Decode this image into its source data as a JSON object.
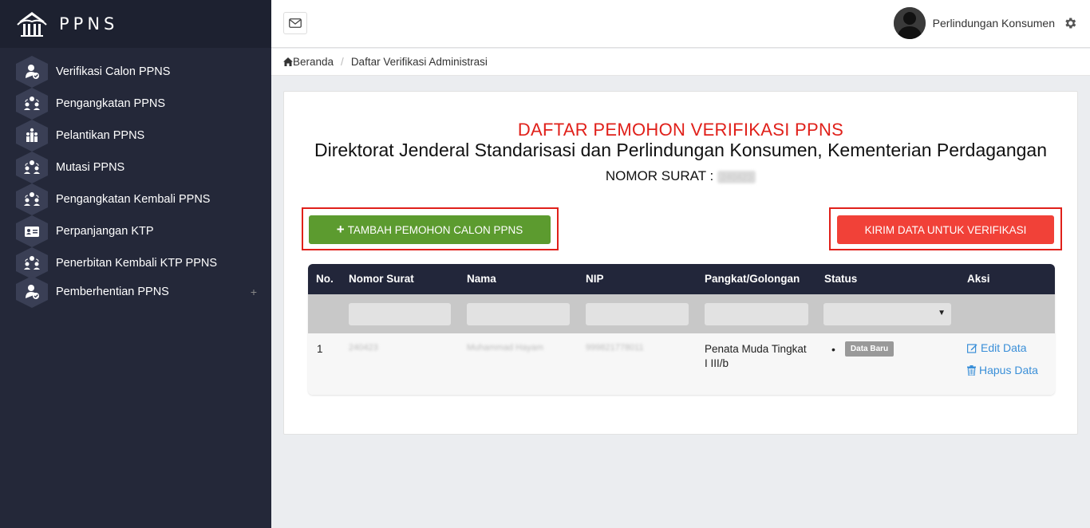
{
  "brand": {
    "name": "PPNS",
    "logo_icon": "ppns-building-logo-icon"
  },
  "sidebar": {
    "items": [
      {
        "label": "Verifikasi Calon PPNS",
        "icon": "user-check-icon"
      },
      {
        "label": "Pengangkatan PPNS",
        "icon": "users-group-icon"
      },
      {
        "label": "Pelantikan PPNS",
        "icon": "people-rows-icon"
      },
      {
        "label": "Mutasi PPNS",
        "icon": "users-group-icon"
      },
      {
        "label": "Pengangkatan Kembali PPNS",
        "icon": "users-group-icon"
      },
      {
        "label": "Perpanjangan KTP",
        "icon": "id-card-icon"
      },
      {
        "label": "Penerbitan Kembali KTP PPNS",
        "icon": "users-group-icon"
      },
      {
        "label": "Pemberhentian PPNS",
        "icon": "user-check-icon",
        "expand": "+"
      }
    ]
  },
  "topbar": {
    "user_name": "Perlindungan Konsumen",
    "mail_icon": "envelope-icon",
    "settings_icon": "gear-icon"
  },
  "breadcrumb": {
    "home": "Beranda",
    "separator": "/",
    "current": "Daftar Verifikasi Administrasi"
  },
  "card": {
    "title": "DAFTAR PEMOHON VERIFIKASI PPNS",
    "subtitle": "Direktorat Jenderal Standarisasi dan Perlindungan Konsumen, Kementerian Perdagangan",
    "nomor_label": "NOMOR SURAT :",
    "nomor_value": "240423"
  },
  "actions": {
    "add_label": "TAMBAH PEMOHON CALON PPNS",
    "add_icon": "+",
    "send_label": "KIRIM DATA UNTUK VERIFIKASI"
  },
  "table": {
    "headers": [
      "No.",
      "Nomor Surat",
      "Nama",
      "NIP",
      "Pangkat/Golongan",
      "Status",
      "Aksi"
    ],
    "rows": [
      {
        "no": "1",
        "nomor_surat": "240423",
        "nama": "Muhammad Hayam",
        "nip": "999821778011",
        "pangkat": "Penata Muda Tingkat I III/b",
        "status": "Data Baru",
        "edit": "Edit Data",
        "hapus": "Hapus Data"
      }
    ]
  },
  "colors": {
    "accent_red": "#e0201a",
    "green": "#5c9b2f",
    "sidebar": "#242839",
    "link": "#3a8fd8"
  }
}
